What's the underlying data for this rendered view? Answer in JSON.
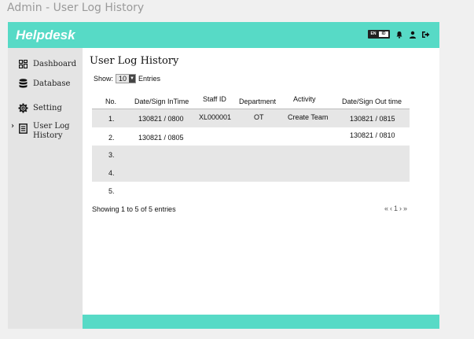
{
  "window": {
    "title": "Admin - User Log History"
  },
  "header": {
    "brand": "Helpdesk",
    "lang_toggle": {
      "left": "EN",
      "right": "ID"
    },
    "colors": {
      "accent": "#57dac6"
    },
    "icons": [
      "language-toggle",
      "bell-icon",
      "user-icon",
      "logout-icon"
    ]
  },
  "sidebar": {
    "items": [
      {
        "label": "Dashboard",
        "icon": "grid-icon"
      },
      {
        "label": "Database",
        "icon": "database-icon"
      },
      {
        "label": "Setting",
        "icon": "gear-icon"
      },
      {
        "label_line1": "User Log",
        "label_line2": "History",
        "icon": "document-icon",
        "active": true
      }
    ]
  },
  "main": {
    "title": "User Log History",
    "show_prefix": "Show:",
    "show_value": "10",
    "show_suffix": "Entries",
    "columns": [
      "No.",
      "Date/Sign InTime",
      "Staff ID",
      "Department",
      "Activity",
      "Date/Sign Out time"
    ],
    "rows": [
      [
        "1.",
        "130821 / 0800",
        "XL000001",
        "OT",
        "Create Team",
        "130821 / 0815"
      ],
      [
        "2.",
        "130821 / 0805",
        "",
        "",
        "",
        "130821 / 0810"
      ],
      [
        "3.",
        "",
        "",
        "",
        "",
        ""
      ],
      [
        "4.",
        "",
        "",
        "",
        "",
        ""
      ],
      [
        "5.",
        "",
        "",
        "",
        "",
        ""
      ]
    ],
    "showing_text": "Showing 1 to 5 of 5 entries",
    "pager": {
      "first": "«",
      "prev": "‹",
      "page": "1",
      "next": "›",
      "last": "»"
    }
  }
}
